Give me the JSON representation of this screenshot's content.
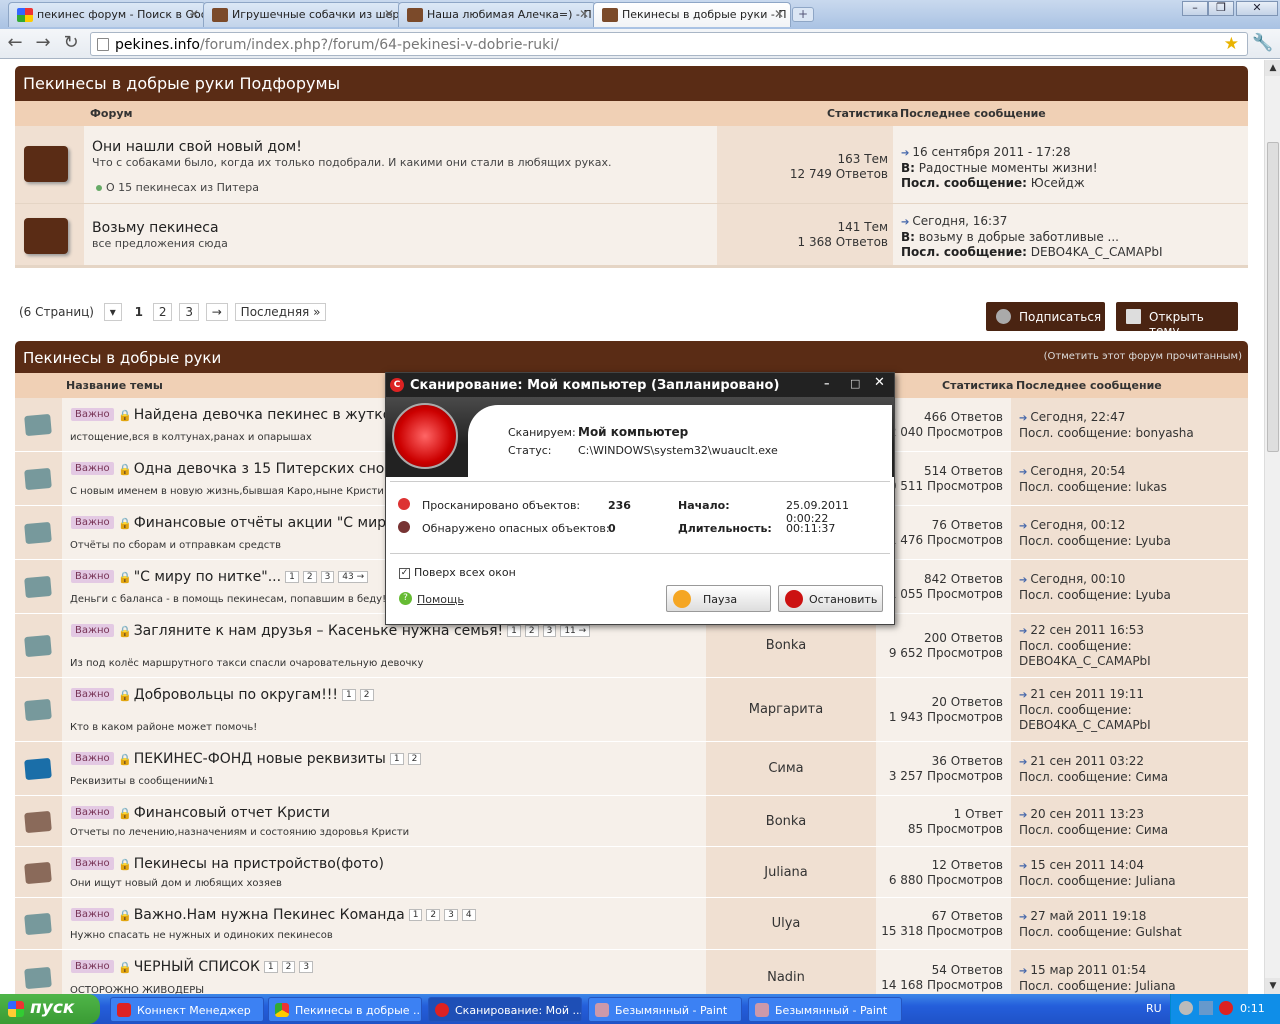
{
  "browser": {
    "tabs": [
      {
        "label": "пекинес форум - Поиск в Goo",
        "icon": "google-icon"
      },
      {
        "label": "Игрушечные собачки из шер",
        "icon": "site-icon"
      },
      {
        "label": "Наша любимая Алечка=) - П",
        "icon": "site-icon"
      },
      {
        "label": "Пекинесы в добрые руки - П",
        "icon": "site-icon"
      }
    ],
    "url_domain": "pekines.info",
    "url_path": "/forum/index.php?/forum/64-pekinesi-v-dobrie-ruki/"
  },
  "subforums": {
    "title": "Пекинесы в добрые руки Подфорумы",
    "col_forum": "Форум",
    "col_stats": "Статистика",
    "col_last": "Последнее сообщение",
    "rows": [
      {
        "title": "Они нашли свой новый дом!",
        "desc": "Что с собаками было, когда их только подобрали. И какими они стали в любящих руках.",
        "sub": "О 15 пекинесах из Питера",
        "topics": "163 Тем",
        "replies": "12 749 Ответов",
        "date": "16 сентября 2011 - 17:28",
        "in_label": "В:",
        "in_topic": "Радостные моменты жизни!",
        "by_label": "Посл. сообщение:",
        "by": "Юсейдж"
      },
      {
        "title": "Возьму пекинеса",
        "desc": "все предложения сюда",
        "sub": "",
        "topics": "141 Тем",
        "replies": "1 368 Ответов",
        "date": "Сегодня, 16:37",
        "in_label": "В:",
        "in_topic": "возьму в добрые заботливые ...",
        "by_label": "Посл. сообщение:",
        "by": "DEBO4KA_C_CAMAPbI"
      }
    ]
  },
  "pagination": {
    "pages_label": "(6 Страниц)",
    "p1": "1",
    "p2": "2",
    "p3": "3",
    "next": "→",
    "last": "Последняя »"
  },
  "actions": {
    "subscribe": "Подписаться",
    "open_topic": "Открыть тему"
  },
  "topics": {
    "title": "Пекинесы в добрые руки",
    "mark_read": "(Отметить этот форум прочитанным)",
    "col_name": "Название темы",
    "col_stats": "Статистика",
    "col_last": "Последнее сообщение",
    "badge": "Важно",
    "rows": [
      {
        "title": "Найдена девочка пекинес в жутком сос",
        "desc": "истощение,вся в колтунах,ранах и опарышах",
        "pages": [],
        "author": "",
        "replies": "466 Ответов",
        "views": "12 040 Просмотров",
        "date": "Сегодня, 22:47",
        "by_label": "Посл. сообщение:",
        "by": "bonyasha"
      },
      {
        "title": "Одна девочка з 15 Питерских снова иш",
        "desc": "С новым именем в новую жизнь,бывшая Каро,ныне Кристи",
        "pages": [],
        "author": "",
        "replies": "514 Ответов",
        "views": "10 511 Просмотров",
        "date": "Сегодня, 20:54",
        "by_label": "Посл. сообщение:",
        "by": "lukas"
      },
      {
        "title": "Финансовые отчёты акции \"С миру по",
        "desc": "Отчёты по сборам и отправкам средств",
        "pages": [],
        "author": "",
        "replies": "76 Ответов",
        "views": "1 476 Просмотров",
        "date": "Сегодня, 00:12",
        "by_label": "Посл. сообщение:",
        "by": "Lyuba"
      },
      {
        "title": "\"С миру по нитке\"...",
        "desc": "Деньги с баланса - в помощь пекинесам, попавшим в беду!",
        "pages": [
          "1",
          "2",
          "3",
          "43 →"
        ],
        "author": "",
        "replies": "842 Ответов",
        "views": "11 055 Просмотров",
        "date": "Сегодня, 00:10",
        "by_label": "Посл. сообщение:",
        "by": "Lyuba"
      },
      {
        "title": "Загляните к нам друзья – Касеньке нужна семья!",
        "desc": "Из под колёс маршрутного такси спасли очаровательную девочку",
        "pages": [
          "1",
          "2",
          "3",
          "11 →"
        ],
        "author": "Bonka",
        "replies": "200 Ответов",
        "views": "9 652 Просмотров",
        "date": "22 сен 2011 16:53",
        "by_label": "Посл. сообщение:",
        "by": "DEBO4KA_C_CAMAPbI"
      },
      {
        "title": "Добровольцы по округам!!!",
        "desc": "Кто в каком районе может помочь!",
        "pages": [
          "1",
          "2"
        ],
        "author": "Маргарита",
        "replies": "20 Ответов",
        "views": "1 943 Просмотров",
        "date": "21 сен 2011 19:11",
        "by_label": "Посл. сообщение:",
        "by": "DEBO4KA_C_CAMAPbI"
      },
      {
        "title": "ПЕКИНЕС-ФОНД новые реквизиты",
        "desc": "Реквизиты в сообщении№1",
        "pages": [
          "1",
          "2"
        ],
        "author": "Сима",
        "replies": "36 Ответов",
        "views": "3 257 Просмотров",
        "date": "21 сен 2011 03:22",
        "by_label": "Посл. сообщение:",
        "by": "Сима"
      },
      {
        "title": "Финансовый отчет Кристи",
        "desc": "Отчеты по лечению,назначениям и состоянию здоровья Кристи",
        "pages": [],
        "author": "Bonka",
        "replies": "1 Ответ",
        "views": "85 Просмотров",
        "date": "20 сен 2011 13:23",
        "by_label": "Посл. сообщение:",
        "by": "Сима"
      },
      {
        "title": "Пекинесы на пристройство(фото)",
        "desc": "Они ищут новый дом и любящих хозяев",
        "pages": [],
        "author": "Juliana",
        "replies": "12 Ответов",
        "views": "6 880 Просмотров",
        "date": "15 сен 2011 14:04",
        "by_label": "Посл. сообщение:",
        "by": "Juliana"
      },
      {
        "title": "Важно.Нам нужна Пекинес Команда",
        "desc": "Нужно спасать не нужных и одиноких пекинесов",
        "pages": [
          "1",
          "2",
          "3",
          "4"
        ],
        "author": "Ulya",
        "replies": "67 Ответов",
        "views": "15 318 Просмотров",
        "date": "27 май 2011 19:18",
        "by_label": "Посл. сообщение:",
        "by": "Gulshat"
      },
      {
        "title": "ЧЕРНЫЙ СПИСОК",
        "desc": "ОСТОРОЖНО ЖИВОДЕРЫ",
        "pages": [
          "1",
          "2",
          "3"
        ],
        "author": "Nadin",
        "replies": "54 Ответов",
        "views": "14 168 Просмотров",
        "date": "15 мар 2011 01:54",
        "by_label": "Посл. сообщение:",
        "by": "Juliana"
      }
    ]
  },
  "scan_dialog": {
    "title": "Сканирование: Мой компьютер (Запланировано)",
    "scanning_label": "Сканируем:",
    "scanning_value": "Мой компьютер",
    "status_label": "Статус:",
    "status_value": "C:\\WINDOWS\\system32\\wuauclt.exe",
    "scanned_label": "Просканировано объектов:",
    "scanned_value": "236",
    "threats_label": "Обнаружено опасных объектов:",
    "threats_value": "0",
    "start_label": "Начало:",
    "start_value": "25.09.2011 0:00:22",
    "duration_label": "Длительность:",
    "duration_value": "00:11:37",
    "ontop_label": "Поверх всех окон",
    "help_label": "Помощь",
    "pause_label": "Пауза",
    "stop_label": "Остановить",
    "accent": "#cc1111"
  },
  "taskbar": {
    "start_label": "пуск",
    "tasks": [
      {
        "label": "Коннект Менеджер"
      },
      {
        "label": "Пекинесы в добрые ..."
      },
      {
        "label": "Сканирование: Мой ..."
      },
      {
        "label": "Безымянный - Paint"
      },
      {
        "label": "Безымянный - Paint"
      }
    ],
    "lang": "RU",
    "clock": "0:11"
  }
}
